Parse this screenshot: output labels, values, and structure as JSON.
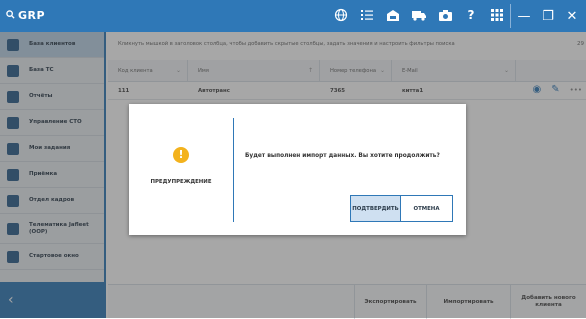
{
  "app": {
    "title": "GRP"
  },
  "toolbar": {
    "icons": [
      "globe-icon",
      "list-icon",
      "car-shop-icon",
      "truck-icon",
      "camera-icon",
      "help-icon",
      "grid-icon"
    ],
    "help_glyph": "?",
    "minimize_glyph": "—",
    "maximize_glyph": "❐",
    "close_glyph": "✕"
  },
  "sidebar": {
    "items": [
      {
        "label": "База клиентов",
        "icon": "clients-icon"
      },
      {
        "label": "База ТС",
        "icon": "vehicles-icon"
      },
      {
        "label": "Отчёты",
        "icon": "reports-icon"
      },
      {
        "label": "Управление СТО",
        "icon": "service-icon"
      },
      {
        "label": "Мои задания",
        "icon": "tasks-icon"
      },
      {
        "label": "Приёмка",
        "icon": "reception-icon"
      },
      {
        "label": "Отдел кадров",
        "icon": "hr-icon"
      },
      {
        "label": "Телематика Jafleet (OOP)",
        "icon": "telematics-icon"
      },
      {
        "label": "Стартовое окно",
        "icon": "home-icon"
      }
    ],
    "collapse_glyph": "‹"
  },
  "main": {
    "hint": "Кликнуть мышкой в заголовок столбца, чтобы добавить скрытые столбцы, задать значения и настроить фильтры поиска",
    "hint_badge": "29",
    "filters": [
      "Код клиента",
      "Имя",
      "Номер телефона",
      "E-Mail"
    ],
    "row": {
      "code": "111",
      "name": "Автотранс",
      "phone": "7365",
      "email": "китта1"
    },
    "bottom": {
      "export": "Экспортировать",
      "import": "Импортировать",
      "add": "Добавить нового клиента"
    }
  },
  "dialog": {
    "icon_glyph": "!",
    "label": "ПРЕДУПРЕЖДЕНИЕ",
    "message": "Будет выполнен импорт данных. Вы хотите продолжить?",
    "confirm": "ПОДТВЕРДИТЬ",
    "cancel": "ОТМЕНА"
  },
  "colors": {
    "accent": "#2f78b7",
    "warning": "#f3b21d"
  }
}
